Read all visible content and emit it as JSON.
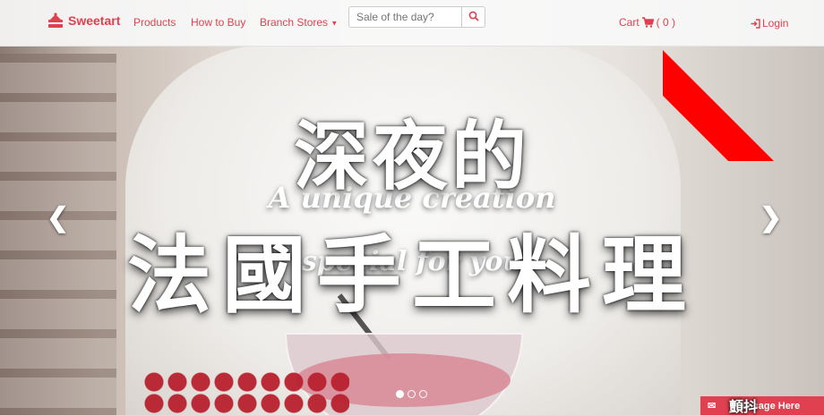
{
  "brand": {
    "name": "Sweetart",
    "color": "#e0404f",
    "icon": "cake-icon"
  },
  "nav": {
    "items": [
      {
        "label": "Products"
      },
      {
        "label": "How to Buy"
      },
      {
        "label": "Branch Stores",
        "icon": "caret-down-icon"
      }
    ]
  },
  "search": {
    "placeholder": "Sale of the day?",
    "icon": "search-icon"
  },
  "cart": {
    "label": "Cart",
    "count": "( 0 )",
    "icon": "cart-icon"
  },
  "login": {
    "label": "Login",
    "icon": "sign-in-icon"
  },
  "hero": {
    "overlay_line1": "深夜的",
    "overlay_line2": "法國手工料理",
    "caption_line1": "A unique creation",
    "caption_line2": "special for you",
    "slide_count": 3,
    "active_slide": 1
  },
  "chat": {
    "label": "Message Here",
    "icon": "envelope-icon",
    "stamp": "顫抖"
  },
  "colors": {
    "accent": "#e0404f",
    "ribbon": "#ff0000"
  }
}
